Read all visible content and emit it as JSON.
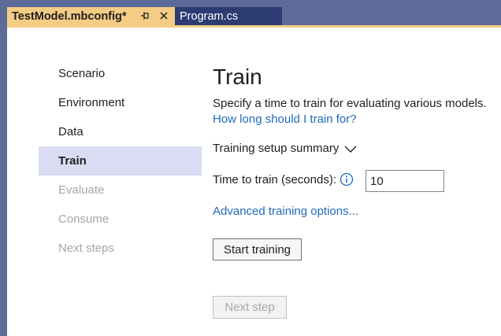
{
  "tabs": [
    {
      "title": "TestModel.mbconfig*",
      "active": true
    },
    {
      "title": "Program.cs",
      "active": false
    }
  ],
  "icons": {
    "pin": "pin-icon",
    "close": "close-icon",
    "chevron": "chevron-down-icon",
    "info": "info-icon"
  },
  "colors": {
    "tabstrip_bg": "#5d6b99",
    "active_tab": "#f5cc84",
    "inactive_tab": "#2c3b72",
    "nav_selected": "#dadcf3",
    "link": "#1f6bb8",
    "info_icon": "#1f6bb8",
    "disabled_text": "#a6a6a6"
  },
  "nav": {
    "items": [
      {
        "label": "Scenario",
        "state": "normal"
      },
      {
        "label": "Environment",
        "state": "normal"
      },
      {
        "label": "Data",
        "state": "normal"
      },
      {
        "label": "Train",
        "state": "selected"
      },
      {
        "label": "Evaluate",
        "state": "disabled"
      },
      {
        "label": "Consume",
        "state": "disabled"
      },
      {
        "label": "Next steps",
        "state": "disabled"
      }
    ]
  },
  "main": {
    "title": "Train",
    "description": "Specify a time to train for evaluating various models.",
    "help_link": "How long should I train for?",
    "summary_label": "Training setup summary",
    "time_label": "Time to train (seconds):",
    "time_value": "10",
    "advanced_link": "Advanced training options...",
    "start_button": "Start training",
    "next_button": "Next step"
  }
}
